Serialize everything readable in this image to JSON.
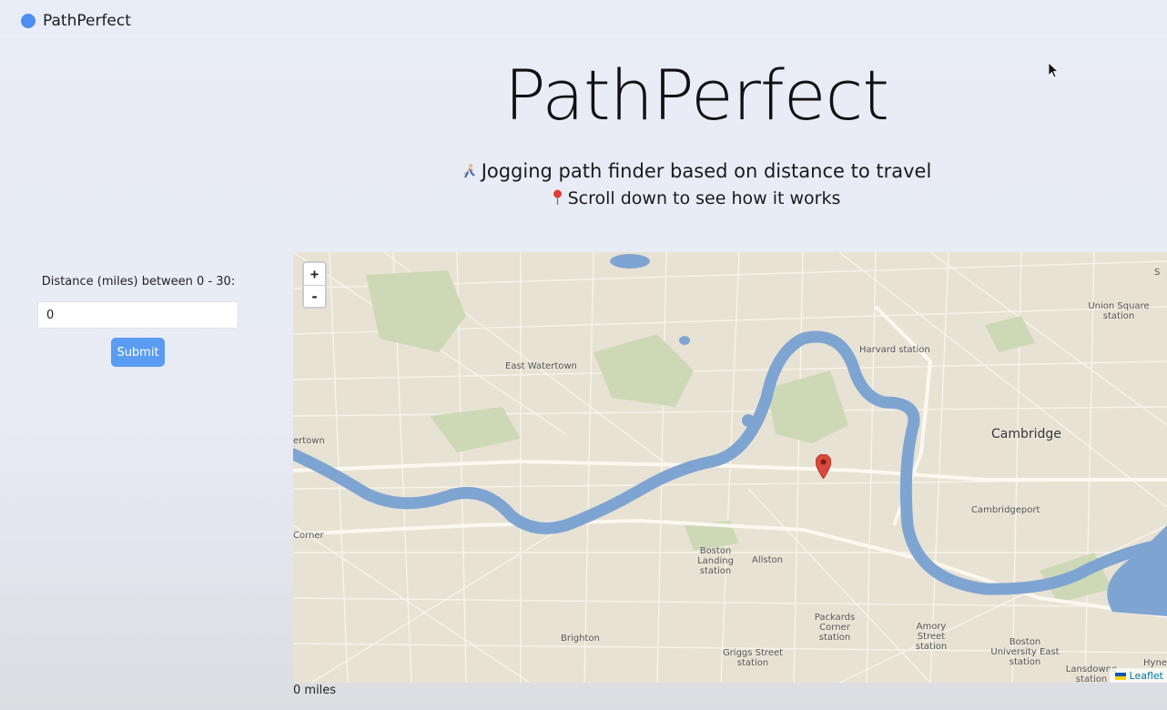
{
  "app": {
    "name": "PathPerfect"
  },
  "hero": {
    "title": "PathPerfect",
    "line1": "Jogging path finder based on distance to travel",
    "line2": "Scroll down to see how it works"
  },
  "form": {
    "label": "Distance (miles) between 0 - 30:",
    "value": "0",
    "submit_label": "Submit"
  },
  "map": {
    "zoom_in": "+",
    "zoom_out": "-",
    "attribution": "Leaflet",
    "labels": {
      "east_watertown": "East Watertown",
      "watertown": "ertown",
      "corner": "Corner",
      "harvard": "Harvard station",
      "union_square": "Union Square station",
      "cambridge": "Cambridge",
      "cambridgeport": "Cambridgeport",
      "boston_landing": "Boston Landing station",
      "allston": "Allston",
      "brighton": "Brighton",
      "packards": "Packards Corner station",
      "amory": "Amory Street station",
      "griggs": "Griggs Street station",
      "bu_east": "Boston University East station",
      "lansdowne": "Lansdowne station",
      "hynes": "Hynes",
      "edge_s": "S"
    }
  },
  "result": {
    "distance_text": "0 miles"
  },
  "colors": {
    "accent": "#5a9cf2",
    "brand_dot": "#4d8ff0",
    "water": "#7ea4d2",
    "park": "#cfdcb8",
    "marker": "#d9483b"
  }
}
